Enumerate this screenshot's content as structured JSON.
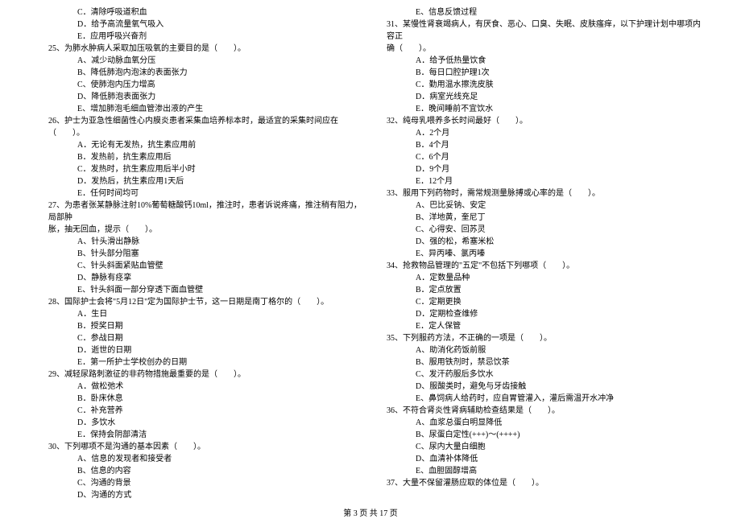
{
  "left_column": [
    {
      "type": "option",
      "text": "C．清除呼吸道积血"
    },
    {
      "type": "option",
      "text": "D．给予高流量氧气吸入"
    },
    {
      "type": "option",
      "text": "E．应用呼吸兴奋剂"
    },
    {
      "type": "question",
      "text": "25、为肺水肿病人采取加压吸氧的主要目的是（　　）。"
    },
    {
      "type": "option",
      "text": "A、减少动脉血氧分压"
    },
    {
      "type": "option",
      "text": "B、降低肺泡内泡沫的表面张力"
    },
    {
      "type": "option",
      "text": "C、使肺泡内压力增高"
    },
    {
      "type": "option",
      "text": "D、降低肺泡表面张力"
    },
    {
      "type": "option",
      "text": "E、增加肺泡毛细血管渗出液的产生"
    },
    {
      "type": "question",
      "text": "26、护士为亚急性细菌性心内膜炎患者采集血培养标本时，最适宜的采集时间应在（　　）。"
    },
    {
      "type": "option",
      "text": "A．无论有无发热，抗生素应用前"
    },
    {
      "type": "option",
      "text": "B．发热前，抗生素应用后"
    },
    {
      "type": "option",
      "text": "C．发热时，抗生素应用后半小时"
    },
    {
      "type": "option",
      "text": "D．发热后，抗生素应用1天后"
    },
    {
      "type": "option",
      "text": "E．任何时间均可"
    },
    {
      "type": "question",
      "text": "27、为患者张某静脉注射10%葡萄糖酸钙10ml，推注时，患者诉说疼痛，推注稍有阻力，局部肿"
    },
    {
      "type": "question-cont",
      "text": "胀，抽无回血，提示（　　）。"
    },
    {
      "type": "option",
      "text": "A、针头滑出静脉"
    },
    {
      "type": "option",
      "text": "B、针头部分阻塞"
    },
    {
      "type": "option",
      "text": "C、针头斜面紧贴血管壁"
    },
    {
      "type": "option",
      "text": "D、静脉有痉挛"
    },
    {
      "type": "option",
      "text": "E、针头斜面一部分穿透下面血管壁"
    },
    {
      "type": "question",
      "text": "28、国际护士会将\"5月12日\"定为国际护士节，这一日期是南丁格尔的（　　）。"
    },
    {
      "type": "option",
      "text": "A．生日"
    },
    {
      "type": "option",
      "text": "B．授奖日期"
    },
    {
      "type": "option",
      "text": "C．参战日期"
    },
    {
      "type": "option",
      "text": "D．逝世的日期"
    },
    {
      "type": "option",
      "text": "E．第一所护士学校创办的日期"
    },
    {
      "type": "question",
      "text": "29、减轻尿路刺激征的非药物措施最重要的是（　　）。"
    },
    {
      "type": "option",
      "text": "A．做松弛术"
    },
    {
      "type": "option",
      "text": "B．卧床休息"
    },
    {
      "type": "option",
      "text": "C．补充营养"
    },
    {
      "type": "option",
      "text": "D．多饮水"
    },
    {
      "type": "option",
      "text": "E．保持会阴部清洁"
    },
    {
      "type": "question",
      "text": "30、下列哪项不是沟通的基本因素（　　）。"
    },
    {
      "type": "option",
      "text": "A、信息的发现者和接受者"
    },
    {
      "type": "option",
      "text": "B、信息的内容"
    },
    {
      "type": "option",
      "text": "C、沟通的背景"
    },
    {
      "type": "option",
      "text": "D、沟通的方式"
    }
  ],
  "right_column": [
    {
      "type": "option",
      "text": "E、信息反馈过程"
    },
    {
      "type": "question",
      "text": "31、某慢性肾衰竭病人，有厌食、恶心、口臭、失眠、皮肤瘙痒，以下护理计划中哪项内容正"
    },
    {
      "type": "question-cont",
      "text": "确（　　）。"
    },
    {
      "type": "option",
      "text": "A．给予低热量饮食"
    },
    {
      "type": "option",
      "text": "B．每日口腔护理1次"
    },
    {
      "type": "option",
      "text": "C．勤用温水擦洗皮肤"
    },
    {
      "type": "option",
      "text": "D．病室光线充足"
    },
    {
      "type": "option",
      "text": "E．晚间睡前不宜饮水"
    },
    {
      "type": "question",
      "text": "32、纯母乳喂养多长时间最好（　　）。"
    },
    {
      "type": "option",
      "text": "A．2个月"
    },
    {
      "type": "option",
      "text": "B．4个月"
    },
    {
      "type": "option",
      "text": "C．6个月"
    },
    {
      "type": "option",
      "text": "D．9个月"
    },
    {
      "type": "option",
      "text": "E．12个月"
    },
    {
      "type": "question",
      "text": "33、服用下列药物时，需常规测量脉搏或心率的是（　　）。"
    },
    {
      "type": "option",
      "text": "A、巴比妥钠、安定"
    },
    {
      "type": "option",
      "text": "B、洋地黄，奎尼丁"
    },
    {
      "type": "option",
      "text": "C、心得安、回苏灵"
    },
    {
      "type": "option",
      "text": "D、强的松，希塞米松"
    },
    {
      "type": "option",
      "text": "E、异丙嗪、氯丙嗪"
    },
    {
      "type": "question",
      "text": "34、抢救物品管理的\"五定\"不包括下列哪项（　　）。"
    },
    {
      "type": "option",
      "text": "A．定数量品种"
    },
    {
      "type": "option",
      "text": "B．定点放置"
    },
    {
      "type": "option",
      "text": "C．定期更换"
    },
    {
      "type": "option",
      "text": "D．定期检查维修"
    },
    {
      "type": "option",
      "text": "E．定人保管"
    },
    {
      "type": "question",
      "text": "35、下列服药方法，不正确的一项是（　　）。"
    },
    {
      "type": "option",
      "text": "A、助消化药饭前服"
    },
    {
      "type": "option",
      "text": "B、服用铁剂时，禁忌饮茶"
    },
    {
      "type": "option",
      "text": "C、发汗药服后多饮水"
    },
    {
      "type": "option",
      "text": "D、服酸类时，避免与牙齿接触"
    },
    {
      "type": "option",
      "text": "E、鼻饲病人给药时，应自胃管灌入，灌后需温开水冲净"
    },
    {
      "type": "question",
      "text": "36、不符合肾炎性肾病辅助检查结果是（　　）。"
    },
    {
      "type": "option",
      "text": "A、血浆总蛋白明显降低"
    },
    {
      "type": "option",
      "text": "B、尿蛋白定性(+++)～(++++)"
    },
    {
      "type": "option",
      "text": "C、尿内大量白细胞"
    },
    {
      "type": "option",
      "text": "D、血清补体降低"
    },
    {
      "type": "option",
      "text": "E、血胆固醇增高"
    },
    {
      "type": "question",
      "text": "37、大量不保留灌肠应取的体位是（　　）。"
    }
  ],
  "footer": "第 3 页 共 17 页"
}
